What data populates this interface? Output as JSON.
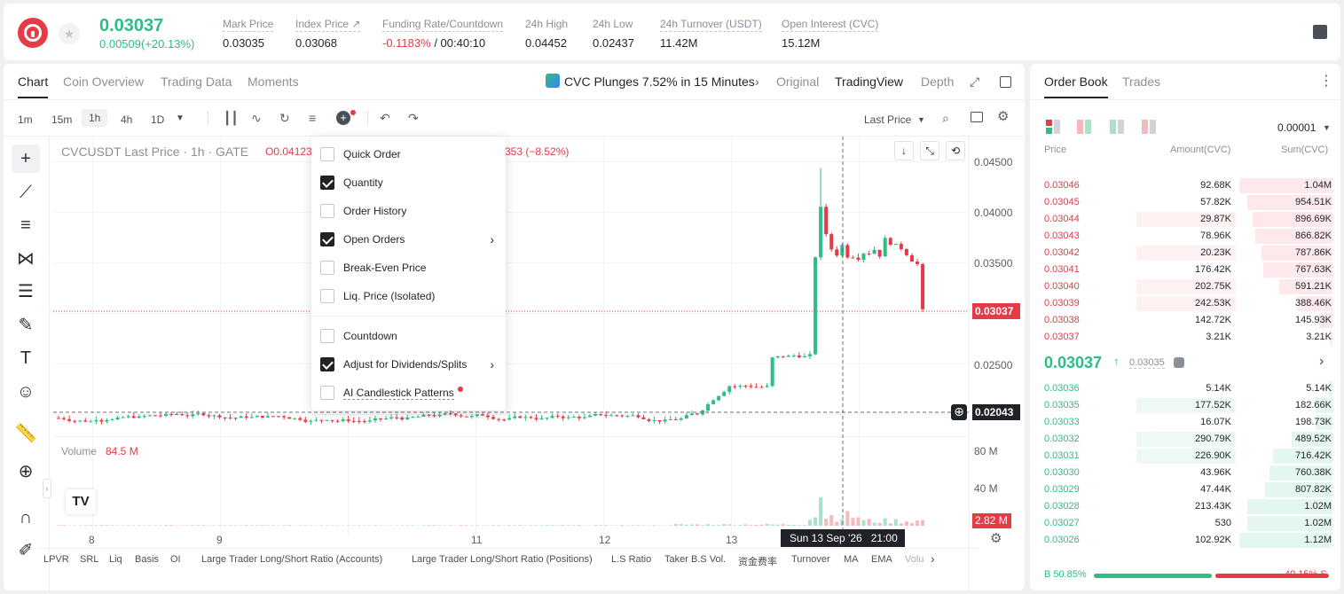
{
  "header": {
    "last_price": "0.03037",
    "change": "0.00509(+20.13%)",
    "stats": [
      {
        "label": "Mark Price",
        "value": "0.03035"
      },
      {
        "label": "Index Price ↗",
        "value": "0.03068"
      },
      {
        "label": "Funding Rate/Countdown",
        "value_red": "-0.1183%",
        "value_rest": "/ 00:40:10"
      },
      {
        "label": "24h High",
        "value": "0.04452"
      },
      {
        "label": "24h Low",
        "value": "0.02437"
      },
      {
        "label": "24h Turnover (USDT)",
        "value": "11.42M"
      },
      {
        "label": "Open Interest (CVC)",
        "value": "15.12M"
      }
    ]
  },
  "chart_tabs": [
    "Chart",
    "Coin Overview",
    "Trading Data",
    "Moments"
  ],
  "news": "CVC Plunges 7.52% in 15 Minutes",
  "view_modes": [
    "Original",
    "TradingView",
    "Depth"
  ],
  "intervals": [
    "1m",
    "15m",
    "1h",
    "4h",
    "1D"
  ],
  "price_type": "Last Price",
  "legend": {
    "symbol": "CVCUSDT Last Price · 1h · GATE",
    "ohlc_open": "O0.04123",
    "change_tail": "353 (−8.52%)"
  },
  "price_axis": [
    "0.04500",
    "0.04000",
    "0.03500",
    "0.02500"
  ],
  "current_price_tag": "0.03037",
  "crosshair_price_tag": "0.02043",
  "volume": {
    "label": "Volume",
    "value": "84.5 M",
    "axis": [
      "80 M",
      "40 M"
    ],
    "tag": "2.82 M"
  },
  "x_axis": [
    "8",
    "9",
    "11",
    "12",
    "13"
  ],
  "crosshair_time": "Sun 13 Sep '26",
  "crosshair_hour": "21:00",
  "menu": [
    {
      "label": "Quick Order",
      "checked": false
    },
    {
      "label": "Quantity",
      "checked": true
    },
    {
      "label": "Order History",
      "checked": false
    },
    {
      "label": "Open Orders",
      "checked": true,
      "submenu": true
    },
    {
      "label": "Break-Even Price",
      "checked": false
    },
    {
      "label": "Liq. Price (Isolated)",
      "checked": false
    },
    {
      "label": "Countdown",
      "checked": false
    },
    {
      "label": "Adjust for Dividends/Splits",
      "checked": true,
      "submenu": true
    },
    {
      "label": "AI Candlestick Patterns",
      "checked": false,
      "dot": true
    }
  ],
  "indicators": [
    "LPVR",
    "SRL",
    "Liq",
    "Basis",
    "OI",
    "Large Trader Long/Short Ratio (Accounts)",
    "Large Trader Long/Short Ratio (Positions)",
    "L.S Ratio",
    "Taker B.S Vol.",
    "资金费率",
    "Turnover",
    "MA",
    "EMA",
    "Volu"
  ],
  "orderbook": {
    "tabs": [
      "Order Book",
      "Trades"
    ],
    "precision": "0.00001",
    "headers": [
      "Price",
      "Amount(CVC)",
      "Sum(CVC)"
    ],
    "asks": [
      {
        "price": "0.03046",
        "amount": "92.68K",
        "sum": "1.04M",
        "amt_pct": 0,
        "sum_pct": 100
      },
      {
        "price": "0.03045",
        "amount": "57.82K",
        "sum": "954.51K",
        "amt_pct": 0,
        "sum_pct": 91
      },
      {
        "price": "0.03044",
        "amount": "29.87K",
        "sum": "896.69K",
        "amt_pct": 60,
        "sum_pct": 86
      },
      {
        "price": "0.03043",
        "amount": "78.96K",
        "sum": "866.82K",
        "amt_pct": 0,
        "sum_pct": 83
      },
      {
        "price": "0.03042",
        "amount": "20.23K",
        "sum": "787.86K",
        "amt_pct": 60,
        "sum_pct": 76
      },
      {
        "price": "0.03041",
        "amount": "176.42K",
        "sum": "767.63K",
        "amt_pct": 0,
        "sum_pct": 74
      },
      {
        "price": "0.03040",
        "amount": "202.75K",
        "sum": "591.21K",
        "amt_pct": 60,
        "sum_pct": 57
      },
      {
        "price": "0.03039",
        "amount": "242.53K",
        "sum": "388.46K",
        "amt_pct": 60,
        "sum_pct": 37
      },
      {
        "price": "0.03038",
        "amount": "142.72K",
        "sum": "145.93K",
        "amt_pct": 0,
        "sum_pct": 14
      },
      {
        "price": "0.03037",
        "amount": "3.21K",
        "sum": "3.21K",
        "amt_pct": 0,
        "sum_pct": 3
      }
    ],
    "mid_price": "0.03037",
    "mid_mark": "0.03035",
    "bids": [
      {
        "price": "0.03036",
        "amount": "5.14K",
        "sum": "5.14K",
        "amt_pct": 0,
        "sum_pct": 4
      },
      {
        "price": "0.03035",
        "amount": "177.52K",
        "sum": "182.66K",
        "amt_pct": 60,
        "sum_pct": 17
      },
      {
        "price": "0.03033",
        "amount": "16.07K",
        "sum": "198.73K",
        "amt_pct": 0,
        "sum_pct": 18
      },
      {
        "price": "0.03032",
        "amount": "290.79K",
        "sum": "489.52K",
        "amt_pct": 60,
        "sum_pct": 44
      },
      {
        "price": "0.03031",
        "amount": "226.90K",
        "sum": "716.42K",
        "amt_pct": 60,
        "sum_pct": 64
      },
      {
        "price": "0.03030",
        "amount": "43.96K",
        "sum": "760.38K",
        "amt_pct": 0,
        "sum_pct": 68
      },
      {
        "price": "0.03029",
        "amount": "47.44K",
        "sum": "807.82K",
        "amt_pct": 0,
        "sum_pct": 72
      },
      {
        "price": "0.03028",
        "amount": "213.43K",
        "sum": "1.02M",
        "amt_pct": 0,
        "sum_pct": 91
      },
      {
        "price": "0.03027",
        "amount": "530",
        "sum": "1.02M",
        "amt_pct": 0,
        "sum_pct": 91
      },
      {
        "price": "0.03026",
        "amount": "102.92K",
        "sum": "1.12M",
        "amt_pct": 0,
        "sum_pct": 100
      }
    ],
    "buy_ratio": "B 50.85%",
    "sell_ratio": "49.15% S",
    "buy_pct": 50.85
  },
  "colors": {
    "up": "#2ebd85",
    "down": "#e63a47"
  }
}
